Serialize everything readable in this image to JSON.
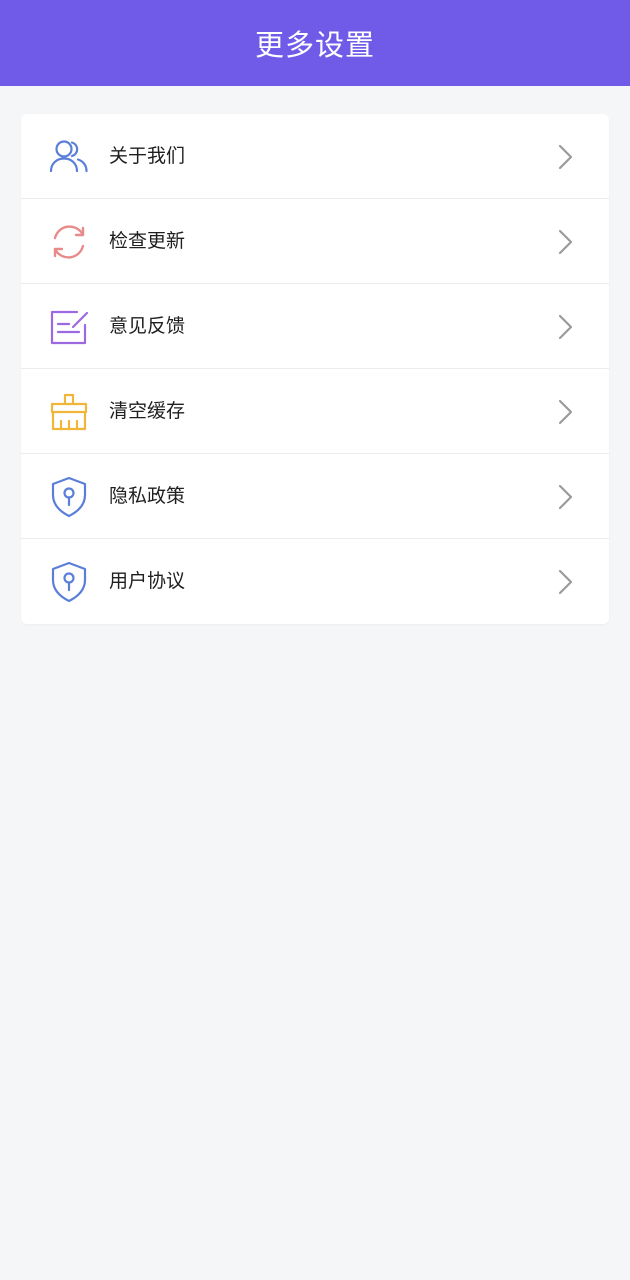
{
  "header": {
    "title": "更多设置",
    "background": "#6f5be8"
  },
  "menu": {
    "items": [
      {
        "label": "关于我们",
        "icon": "users-icon",
        "color": "#5b7fd9"
      },
      {
        "label": "检查更新",
        "icon": "refresh-icon",
        "color": "#e98a8a"
      },
      {
        "label": "意见反馈",
        "icon": "feedback-icon",
        "color": "#9b6ae0"
      },
      {
        "label": "清空缓存",
        "icon": "broom-icon",
        "color": "#f0b63a"
      },
      {
        "label": "隐私政策",
        "icon": "shield-lock-icon",
        "color": "#5b7fd9"
      },
      {
        "label": "用户协议",
        "icon": "shield-lock-icon",
        "color": "#5b7fd9"
      }
    ],
    "chevron_icon": "chevron-right-icon"
  }
}
